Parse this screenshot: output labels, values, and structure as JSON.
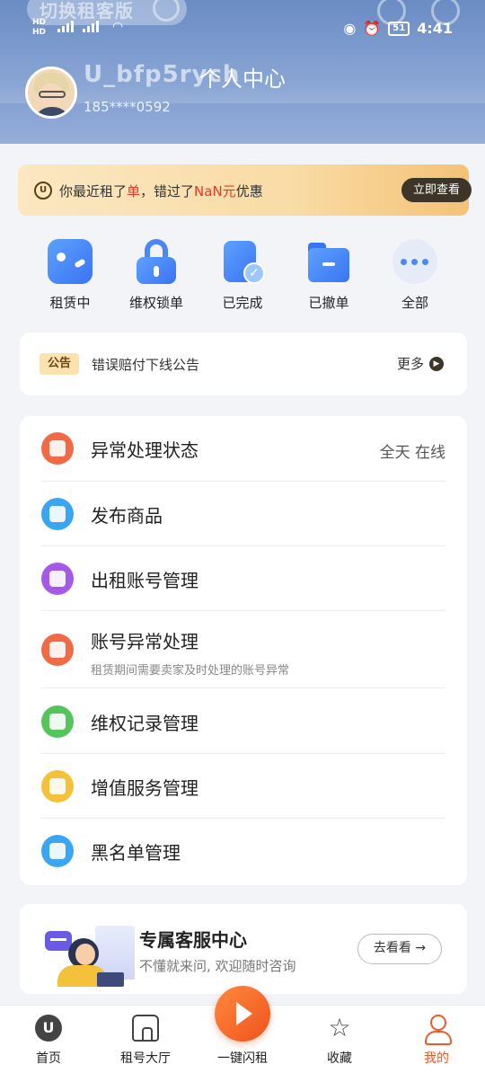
{
  "status_bar": {
    "network_left": "HD\nHD",
    "signal": "4G",
    "time": "4:41",
    "battery": "51"
  },
  "header": {
    "switch_label": "切换租客版",
    "username": "U_bfp5rych",
    "page_title": "个人中心",
    "phone": "185****0592"
  },
  "promo": {
    "text_prefix": "你最近租了",
    "text_highlight1": "单",
    "text_middle": "，错过了",
    "text_highlight2": "NaN元",
    "text_suffix": "优惠",
    "button": "立即查看"
  },
  "orders": [
    {
      "label": "租赁中",
      "icon": "gamepad-icon"
    },
    {
      "label": "维权锁单",
      "icon": "lock-icon"
    },
    {
      "label": "已完成",
      "icon": "completed-doc-icon"
    },
    {
      "label": "已撤单",
      "icon": "folder-icon"
    },
    {
      "label": "全部",
      "icon": "more-dots-icon"
    }
  ],
  "notice": {
    "tag": "公告",
    "text": "错误赔付下线公告",
    "more": "更多"
  },
  "menu": [
    {
      "label": "异常处理状态",
      "right": "全天 在线",
      "icon": "exception-status-icon",
      "color": "#f06a45"
    },
    {
      "label": "发布商品",
      "icon": "publish-grid-icon",
      "color": "#3aa6f2"
    },
    {
      "label": "出租账号管理",
      "icon": "rent-account-icon",
      "color": "#a45ae6"
    },
    {
      "label": "账号异常处理",
      "sub": "租赁期间需要卖家及时处理的账号异常",
      "icon": "alarm-clock-icon",
      "color": "#f06a45"
    },
    {
      "label": "维权记录管理",
      "icon": "record-list-icon",
      "color": "#55c45a"
    },
    {
      "label": "增值服务管理",
      "icon": "value-service-icon",
      "color": "#f4c23a"
    },
    {
      "label": "黑名单管理",
      "icon": "blacklist-users-icon",
      "color": "#3aa6f2"
    }
  ],
  "service": {
    "title": "专属客服中心",
    "subtitle": "不懂就来问, 欢迎随时咨询",
    "button": "去看看 →"
  },
  "tabbar": {
    "items": [
      {
        "label": "首页",
        "icon": "home-u-icon"
      },
      {
        "label": "租号大厅",
        "icon": "hall-icon"
      },
      {
        "label": "一键闪租",
        "icon": "flash-rent-icon"
      },
      {
        "label": "收藏",
        "icon": "star-icon"
      },
      {
        "label": "我的",
        "icon": "me-icon"
      }
    ],
    "active": "我的",
    "active_color": "#f05a2b"
  }
}
